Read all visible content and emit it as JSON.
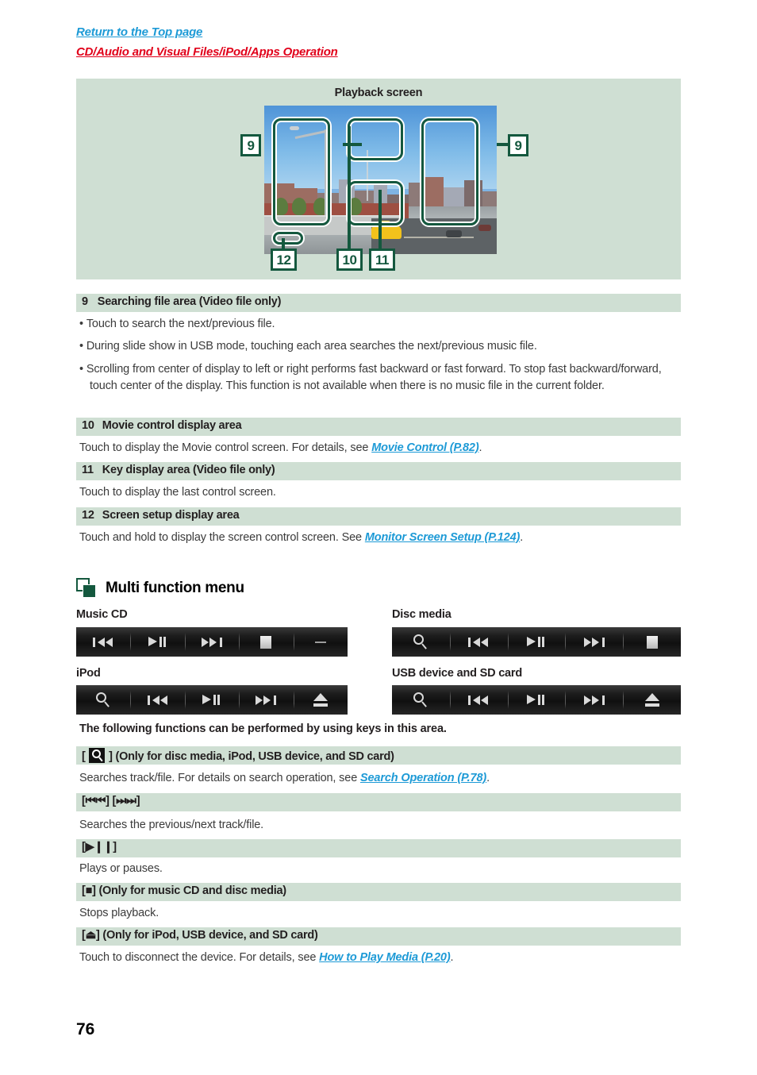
{
  "header": {
    "return_link": "Return to the Top page",
    "section_link": "CD/Audio and Visual Files/iPod/Apps Operation"
  },
  "diagram": {
    "title": "Playback screen",
    "callouts": [
      {
        "id": "9-left",
        "label": "9"
      },
      {
        "id": "9-right",
        "label": "9"
      },
      {
        "id": "12",
        "label": "12"
      },
      {
        "id": "10",
        "label": "10"
      },
      {
        "id": "11",
        "label": "11"
      }
    ]
  },
  "sections": [
    {
      "num": "9",
      "title": "Searching file area (Video file only)",
      "bullets": [
        "Touch to search the next/previous file.",
        "During slide show in USB mode, touching each area searches the next/previous music file.",
        "Scrolling from center of display to left or right performs fast backward or fast forward. To stop fast backward/forward, touch center of the display. This function is not available when there is no music file in the current folder."
      ]
    },
    {
      "num": "10",
      "title": "Movie control display area",
      "body_before": "Touch to display the Movie control screen. For details, see ",
      "ref": "Movie Control (P.82)",
      "body_after": "."
    },
    {
      "num": "11",
      "title": "Key display area (Video file only)",
      "body_before": "Touch to display the last control screen.",
      "ref": "",
      "body_after": ""
    },
    {
      "num": "12",
      "title": "Screen setup display area",
      "body_before": "Touch and hold to display the screen control screen. See ",
      "ref": "Monitor Screen Setup (P.124)",
      "body_after": "."
    }
  ],
  "multi_function_menu": {
    "heading": "Multi function menu",
    "icon": "stacked-squares-icon",
    "groups": [
      {
        "label": "Music CD",
        "keys": [
          "prev-icon",
          "play-pause-icon",
          "next-icon",
          "stop-icon",
          "dash-icon"
        ]
      },
      {
        "label": "Disc media",
        "keys": [
          "search-icon",
          "prev-icon",
          "play-pause-icon",
          "next-icon",
          "stop-icon"
        ]
      },
      {
        "label": "iPod",
        "keys": [
          "search-icon",
          "prev-icon",
          "play-pause-icon",
          "next-icon",
          "eject-icon"
        ]
      },
      {
        "label": "USB device and SD card",
        "keys": [
          "search-icon",
          "prev-icon",
          "play-pause-icon",
          "next-icon",
          "eject-icon"
        ]
      }
    ],
    "intro": "The following functions can be performed by using keys in this area.",
    "functions": [
      {
        "key_prefix": "[ ",
        "key_glyph": "search-icon",
        "key_suffix": " ] (Only for disc media, iPod, USB device, and SD card)",
        "body_before": "Searches track/file. For details on search operation, see ",
        "ref": "Search Operation (P.78)",
        "body_after": "."
      },
      {
        "key_prefix": "[⏮⏮] [⏭⏭]",
        "key_glyph": "",
        "key_suffix": "",
        "body_before": "Searches the previous/next track/file.",
        "ref": "",
        "body_after": ""
      },
      {
        "key_prefix": "[▶❙❙]",
        "key_glyph": "",
        "key_suffix": "",
        "body_before": "Plays or pauses.",
        "ref": "",
        "body_after": ""
      },
      {
        "key_prefix": "[■] (Only for music CD and disc media)",
        "key_glyph": "",
        "key_suffix": "",
        "body_before": "Stops playback.",
        "ref": "",
        "body_after": ""
      },
      {
        "key_prefix": "[⏏] (Only for iPod, USB device, and SD card)",
        "key_glyph": "",
        "key_suffix": "",
        "body_before": "Touch to disconnect the device. For details, see ",
        "ref": "How to Play Media (P.20)",
        "body_after": "."
      }
    ]
  },
  "footer": {
    "page_number": "76"
  },
  "colors": {
    "bar_bg": "#cfdfd3",
    "accent_green": "#14583e",
    "link_blue": "#1d9ad6",
    "link_red": "#e1001a"
  }
}
